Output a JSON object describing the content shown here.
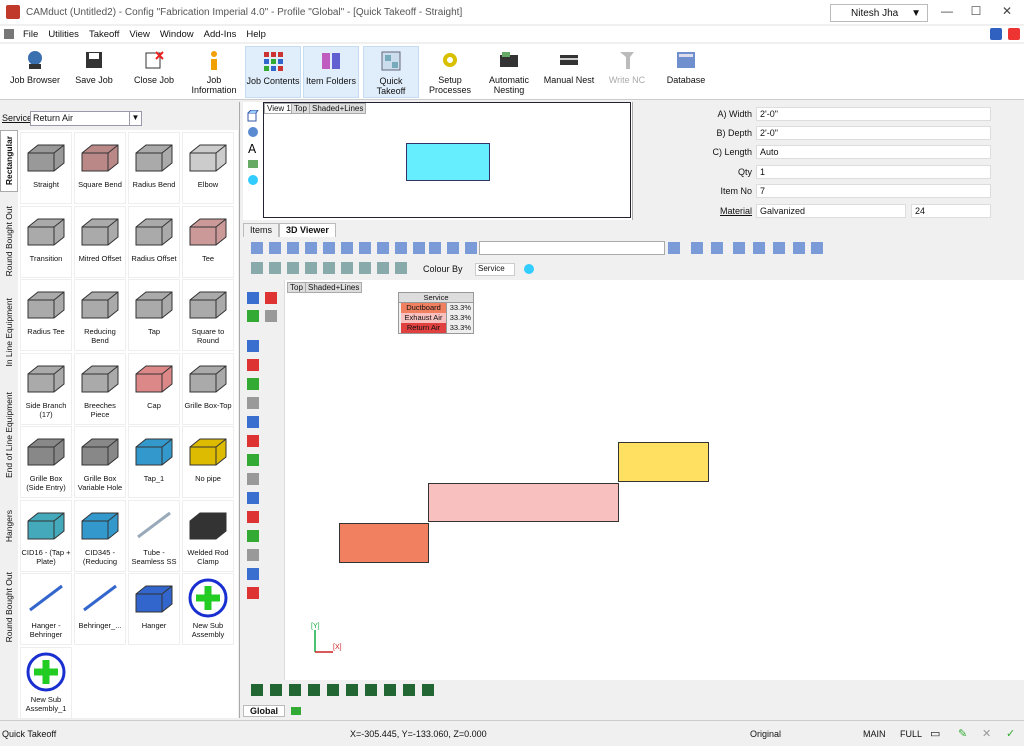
{
  "window": {
    "title": "CAMduct (Untitled2) - Config \"Fabrication Imperial 4.0\" - Profile \"Global\" - [Quick Takeoff - Straight]",
    "user": "Nitesh Jha",
    "controls": [
      "—",
      "☐",
      "✕"
    ]
  },
  "menu": [
    "File",
    "Utilities",
    "Takeoff",
    "View",
    "Window",
    "Add-Ins",
    "Help"
  ],
  "ribbon": [
    {
      "label": "Job Browser",
      "icon": "job-browser-icon"
    },
    {
      "label": "Save Job",
      "icon": "save-icon"
    },
    {
      "label": "Close Job",
      "icon": "close-job-icon"
    },
    {
      "label": "Job Information",
      "icon": "info-icon"
    },
    {
      "label": "Job Contents",
      "icon": "grid-icon"
    },
    {
      "label": "Item Folders",
      "icon": "folders-icon"
    },
    {
      "label": "Quick Takeoff",
      "icon": "takeoff-icon"
    },
    {
      "label": "Setup Processes",
      "icon": "setup-gear-icon"
    },
    {
      "label": "Automatic Nesting",
      "icon": "auto-nest-icon"
    },
    {
      "label": "Manual Nest",
      "icon": "manual-nest-icon"
    },
    {
      "label": "Write NC",
      "icon": "write-nc-icon"
    },
    {
      "label": "Database",
      "icon": "database-icon"
    }
  ],
  "service": {
    "label": "Service",
    "value": "Return Air"
  },
  "vertical_tabs": [
    "Rectangular",
    "Round Bought Out",
    "In Line Equipment",
    "End of Line Equipment",
    "Hangers",
    "Round Bought Out"
  ],
  "palette": [
    {
      "label": "Straight"
    },
    {
      "label": "Square Bend"
    },
    {
      "label": "Radius Bend"
    },
    {
      "label": "Elbow"
    },
    {
      "label": "Transition"
    },
    {
      "label": "Mitred Offset"
    },
    {
      "label": "Radius Offset"
    },
    {
      "label": "Tee"
    },
    {
      "label": "Radius Tee"
    },
    {
      "label": "Reducing Bend"
    },
    {
      "label": "Tap"
    },
    {
      "label": "Square to Round"
    },
    {
      "label": "Side Branch (17)"
    },
    {
      "label": "Breeches Piece"
    },
    {
      "label": "Cap"
    },
    {
      "label": "Grille Box-Top"
    },
    {
      "label": "Grille Box (Side Entry)"
    },
    {
      "label": "Grille Box Variable Hole"
    },
    {
      "label": "Tap_1"
    },
    {
      "label": "No pipe"
    },
    {
      "label": "CID16 - (Tap + Plate)"
    },
    {
      "label": "CID345 - (Reducing"
    },
    {
      "label": "Tube - Seamless SS"
    },
    {
      "label": "Welded Rod Clamp"
    },
    {
      "label": "Hanger - Behringer"
    },
    {
      "label": "Behringer_..."
    },
    {
      "label": "Hanger"
    },
    {
      "label": "New Sub Assembly"
    },
    {
      "label": "New Sub Assembly_1"
    }
  ],
  "topview": {
    "tab1": "View 1",
    "tab2": "Top",
    "tab3": "Shaded+Lines"
  },
  "properties": [
    {
      "label": "A) Width",
      "value": "2'-0\""
    },
    {
      "label": "B) Depth",
      "value": "2'-0\""
    },
    {
      "label": "C) Length",
      "value": "Auto"
    },
    {
      "label": "Qty",
      "value": "1"
    },
    {
      "label": "Item No",
      "value": "7"
    },
    {
      "label": "Material",
      "value": "Galvanized",
      "gauge": "24"
    }
  ],
  "tabs": [
    "Items",
    "3D Viewer"
  ],
  "viewer": {
    "colour_by_label": "Colour By",
    "colour_by_value": "Service",
    "view_label_1": "Top",
    "view_label_2": "Shaded+Lines",
    "legend_title": "Service",
    "legend": [
      {
        "name": "Ductboard",
        "pct": "33.3%",
        "color": "#f08060"
      },
      {
        "name": "Exhaust Air",
        "pct": "33.3%",
        "color": "#f9c0c0"
      },
      {
        "name": "Return Air",
        "pct": "33.3%",
        "color": "#e04040"
      }
    ],
    "axis_y": "[Y]",
    "axis_x": "[X]"
  },
  "global_tab": "Global",
  "status": {
    "mode": "Quick Takeoff",
    "coords": "X=-305.445, Y=-133.060, Z=0.000",
    "original": "Original",
    "main": "MAIN",
    "full": "FULL"
  },
  "colors": {
    "accent": "#3060c0",
    "top_rect": "#66eeff"
  }
}
